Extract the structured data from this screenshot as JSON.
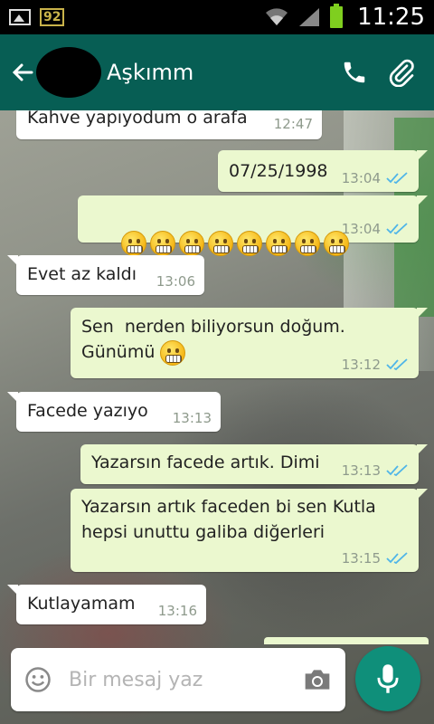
{
  "status_bar": {
    "badge": "92",
    "time": "11:25"
  },
  "header": {
    "contact_name": "Aşkımm",
    "icons": [
      "back-arrow-icon",
      "phone-icon",
      "paperclip-icon"
    ],
    "color": "#075e54"
  },
  "messages": [
    {
      "dir": "in",
      "text": "Kahve yapıyodum o arafa",
      "time": "12:47"
    },
    {
      "dir": "out",
      "text": "07/25/1998",
      "time": "13:04",
      "ticks": true
    },
    {
      "dir": "out",
      "emoji_count": 8,
      "time": "13:04",
      "ticks": true
    },
    {
      "dir": "in",
      "text": "Evet az kaldı",
      "time": "13:06"
    },
    {
      "dir": "out",
      "text": "Sen  nerden biliyorsun doğum.",
      "text2": "Günümü",
      "time": "13:12",
      "ticks": true
    },
    {
      "dir": "in",
      "text": "Facede yazıyo",
      "time": "13:13"
    },
    {
      "dir": "out",
      "text": "Yazarsın facede artık. Dimi",
      "time": "13:13",
      "ticks": true
    },
    {
      "dir": "out",
      "text": "Yazarsın artık faceden bi sen Kutla",
      "text2": "hepsi unuttu galiba diğerleri",
      "time": "13:15",
      "ticks": true
    },
    {
      "dir": "in",
      "text": "Kutlayamam",
      "time": "13:16"
    }
  ],
  "input": {
    "placeholder": "Bir mesaj yaz"
  },
  "colors": {
    "incoming_bubble": "#ffffff",
    "outgoing_bubble": "#ebf8cf",
    "ticks": "#4fb5e8",
    "mic_button": "#0f8f7a"
  }
}
